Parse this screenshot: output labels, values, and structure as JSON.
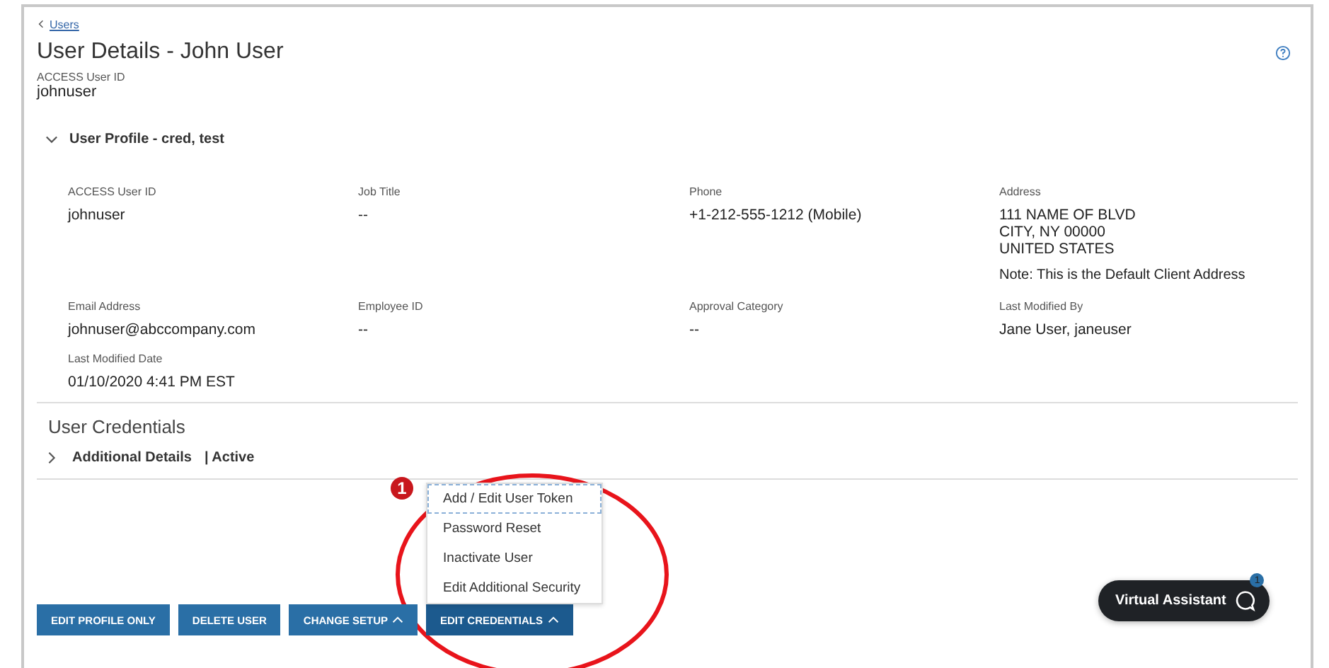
{
  "back_link": {
    "label": "Users"
  },
  "title": "User Details - John User",
  "user_id": {
    "label": "ACCESS User ID",
    "value": "johnuser"
  },
  "profile": {
    "title": "User Profile - cred, test",
    "expanded": true,
    "fields": [
      {
        "label": "ACCESS User ID",
        "lines": [
          "johnuser"
        ]
      },
      {
        "label": "Job Title",
        "lines": [
          "--"
        ]
      },
      {
        "label": "Phone",
        "lines": [
          "+1-212-555-1212 (Mobile)"
        ]
      },
      {
        "label": "Address",
        "lines": [
          "111 NAME OF BLVD",
          "CITY, NY  00000",
          "UNITED STATES"
        ],
        "note": "Note: This is the Default Client Address"
      },
      {
        "label": "Email Address",
        "lines": [
          "johnuser@abccompany.com"
        ]
      },
      {
        "label": "Employee ID",
        "lines": [
          "--"
        ]
      },
      {
        "label": "Approval Category",
        "lines": [
          "--"
        ]
      },
      {
        "label": "Last Modified By",
        "lines": [
          "Jane User,  janeuser"
        ]
      },
      {
        "label": "Last Modified Date",
        "lines": [
          "01/10/2020 4:41 PM EST"
        ]
      }
    ]
  },
  "credentials": {
    "title": "User Credentials",
    "items": [
      {
        "title": "Additional Details",
        "status": "| Active",
        "expanded": false
      }
    ]
  },
  "buttons": [
    {
      "label": "EDIT PROFILE ONLY",
      "caret": false,
      "open": false
    },
    {
      "label": "DELETE USER",
      "caret": false,
      "open": false
    },
    {
      "label": "CHANGE SETUP",
      "caret": true,
      "open": false
    },
    {
      "label": "EDIT CREDENTIALS",
      "caret": true,
      "open": true
    }
  ],
  "menu": {
    "items": [
      {
        "label": "Add / Edit User Token",
        "focused": true
      },
      {
        "label": "Password Reset",
        "focused": false
      },
      {
        "label": "Inactivate User",
        "focused": false
      },
      {
        "label": "Edit Additional Security",
        "focused": false
      }
    ]
  },
  "virtual_assistant": {
    "label": "Virtual Assistant",
    "badge": "1"
  },
  "callout": {
    "number": "1"
  }
}
